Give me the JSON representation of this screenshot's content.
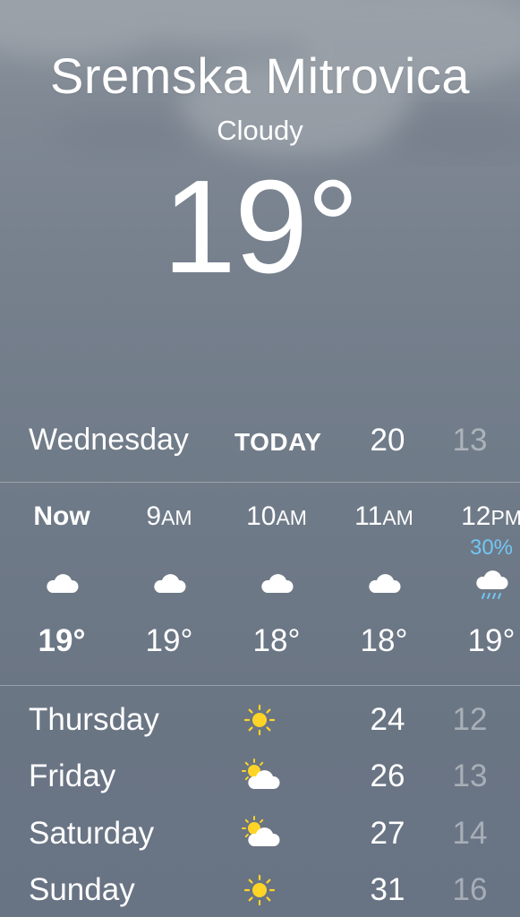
{
  "location": {
    "city": "Sremska Mitrovica",
    "condition": "Cloudy",
    "temperature": "19°"
  },
  "today": {
    "day": "Wednesday",
    "label": "TODAY",
    "high": "20",
    "low": "13"
  },
  "hourly": [
    {
      "time": "Now",
      "ampm": "",
      "icon": "cloud-icon",
      "temp": "19°",
      "precip": ""
    },
    {
      "time": "9",
      "ampm": "AM",
      "icon": "cloud-icon",
      "temp": "19°",
      "precip": ""
    },
    {
      "time": "10",
      "ampm": "AM",
      "icon": "cloud-icon",
      "temp": "18°",
      "precip": ""
    },
    {
      "time": "11",
      "ampm": "AM",
      "icon": "cloud-icon",
      "temp": "18°",
      "precip": ""
    },
    {
      "time": "12",
      "ampm": "PM",
      "icon": "rain-cloud-icon",
      "temp": "19°",
      "precip": "30%"
    }
  ],
  "daily": [
    {
      "day": "Thursday",
      "icon": "sun-icon",
      "high": "24",
      "low": "12"
    },
    {
      "day": "Friday",
      "icon": "partly-cloudy-icon",
      "high": "26",
      "low": "13"
    },
    {
      "day": "Saturday",
      "icon": "partly-cloudy-icon",
      "high": "27",
      "low": "14"
    },
    {
      "day": "Sunday",
      "icon": "sun-icon",
      "high": "31",
      "low": "16"
    }
  ],
  "colors": {
    "sun": "#ffd426",
    "precip": "#72c6f4",
    "rain": "#72c6f4",
    "cloud": "#ffffff"
  }
}
